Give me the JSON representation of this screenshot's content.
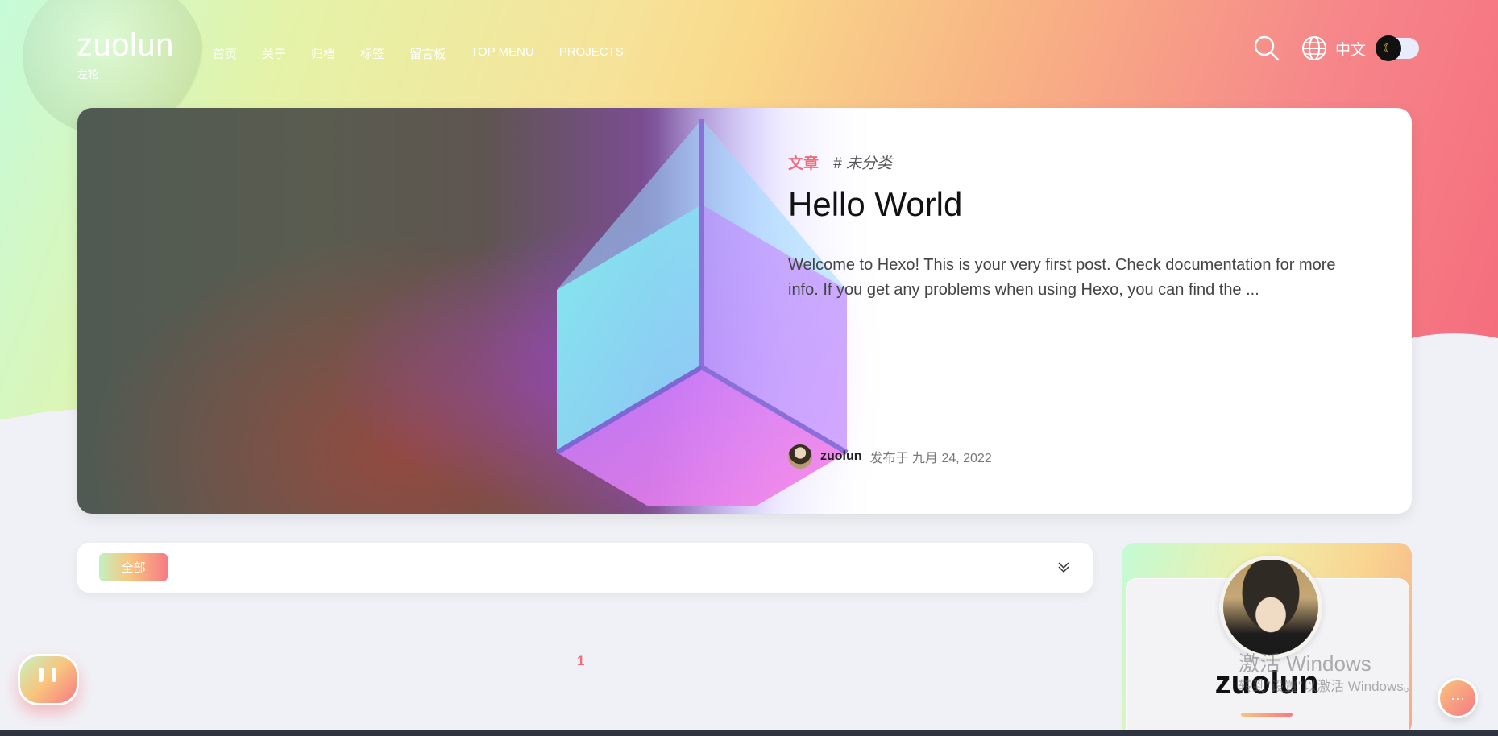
{
  "site": {
    "title": "zuolun",
    "subtitle": "左轮"
  },
  "nav": [
    {
      "label": "首页"
    },
    {
      "label": "关于"
    },
    {
      "label": "归档"
    },
    {
      "label": "标签"
    },
    {
      "label": "留言板"
    },
    {
      "label": "TOP MENU"
    },
    {
      "label": "PROJECTS"
    }
  ],
  "header": {
    "language_label": "中文",
    "icons": [
      "search-icon",
      "globe-icon",
      "moon-icon"
    ],
    "dark_mode": false
  },
  "featured_post": {
    "category": "文章",
    "tag": "# 未分类",
    "title": "Hello World",
    "excerpt": "Welcome to Hexo! This is your very first post. Check documentation for more info. If you get any problems when using Hexo, you can find the ...",
    "author": "zuolun",
    "date": "发布于 九月 24, 2022"
  },
  "filter": {
    "active_chip": "全部",
    "icons": [
      "chevron-double-down-icon"
    ]
  },
  "pagination": {
    "current": "1"
  },
  "profile": {
    "name": "zuolun"
  },
  "watermark": {
    "title": "激活 Windows",
    "subtitle": "转到\"设置\"以激活 Windows。"
  },
  "floating": {
    "menu_glyph": "···"
  },
  "colors": {
    "accent": "#f36b7b",
    "gradient_start": "#c6fbd9",
    "gradient_mid": "#f9d98b",
    "gradient_end": "#f56b7c"
  }
}
